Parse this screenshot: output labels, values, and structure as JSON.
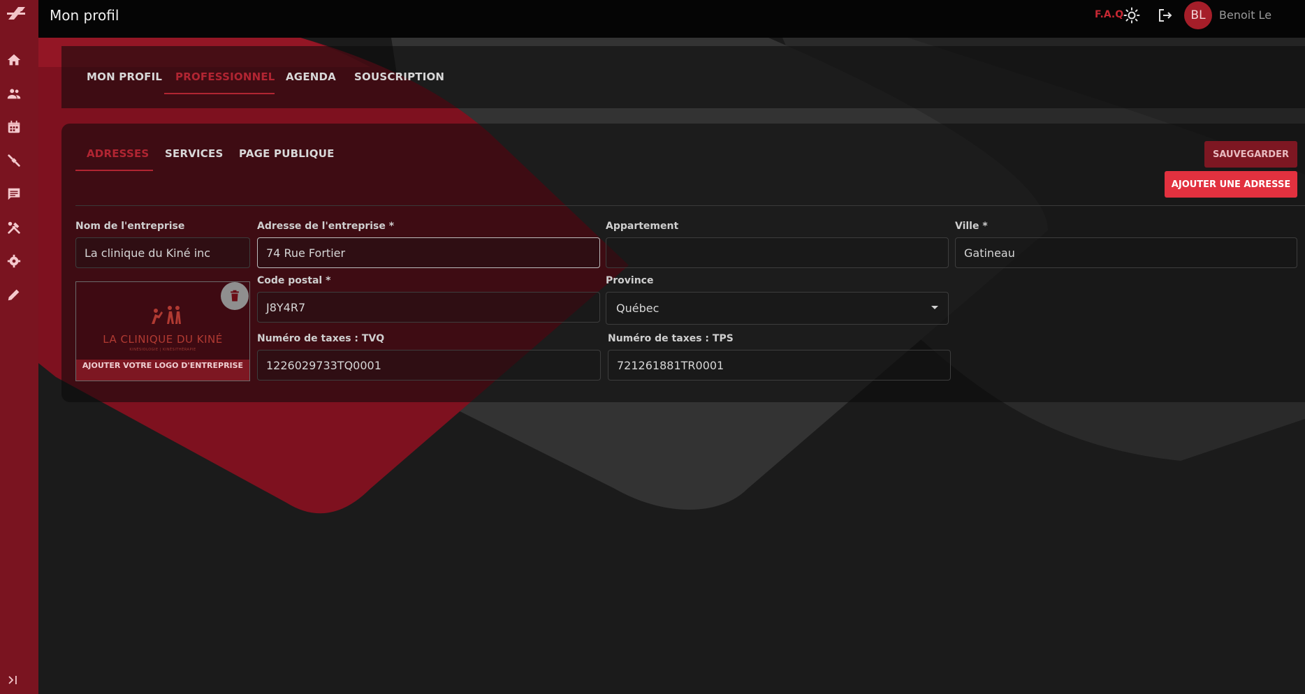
{
  "topbar": {
    "title": "Mon profil",
    "faq": "F.A.Q",
    "avatar_initials": "BL",
    "username": "Benoit Le"
  },
  "sidebar": {
    "items": [
      {
        "icon": "home-icon"
      },
      {
        "icon": "people-icon"
      },
      {
        "icon": "calendar-icon"
      },
      {
        "icon": "exercise-icon"
      },
      {
        "icon": "message-icon"
      },
      {
        "icon": "tools-icon"
      },
      {
        "icon": "gear-icon"
      },
      {
        "icon": "pencil-icon"
      }
    ],
    "collapse_icon": "collapse-icon"
  },
  "main_tabs": {
    "items": [
      {
        "label": "MON PROFIL",
        "active": false
      },
      {
        "label": "PROFESSIONNEL",
        "active": true
      },
      {
        "label": "AGENDA",
        "active": false
      },
      {
        "label": "SOUSCRIPTION",
        "active": false
      }
    ]
  },
  "sub_tabs": {
    "items": [
      {
        "label": "ADRESSES",
        "active": true
      },
      {
        "label": "SERVICES",
        "active": false
      },
      {
        "label": "PAGE PUBLIQUE",
        "active": false
      }
    ]
  },
  "actions": {
    "save": "SAUVEGARDER",
    "add_address": "AJOUTER UNE ADRESSE"
  },
  "form": {
    "company_name": {
      "label": "Nom de l'entreprise",
      "value": "La clinique du Kiné inc"
    },
    "address": {
      "label": "Adresse de l'entreprise *",
      "value": "74 Rue Fortier"
    },
    "apartment": {
      "label": "Appartement",
      "value": ""
    },
    "city": {
      "label": "Ville *",
      "value": "Gatineau"
    },
    "postal_code": {
      "label": "Code postal *",
      "value": "J8Y4R7"
    },
    "province": {
      "label": "Province",
      "value": "Québec"
    },
    "tvq": {
      "label": "Numéro de taxes : TVQ",
      "value": "1226029733TQ0001"
    },
    "tps": {
      "label": "Numéro de taxes : TPS",
      "value": "721261881TR0001"
    }
  },
  "logo": {
    "brand": "LA CLINIQUE DU KINÉ",
    "tagline": "KINÉSIOLOGIE | KINÉSITHÉRAPIE",
    "caption": "AJOUTER VOTRE LOGO D'ENTREPRISE"
  },
  "colors": {
    "accent": "#e2313f",
    "sidebar": "#7a1420",
    "active_tab": "#b12532",
    "background": "#1b1b1b"
  }
}
